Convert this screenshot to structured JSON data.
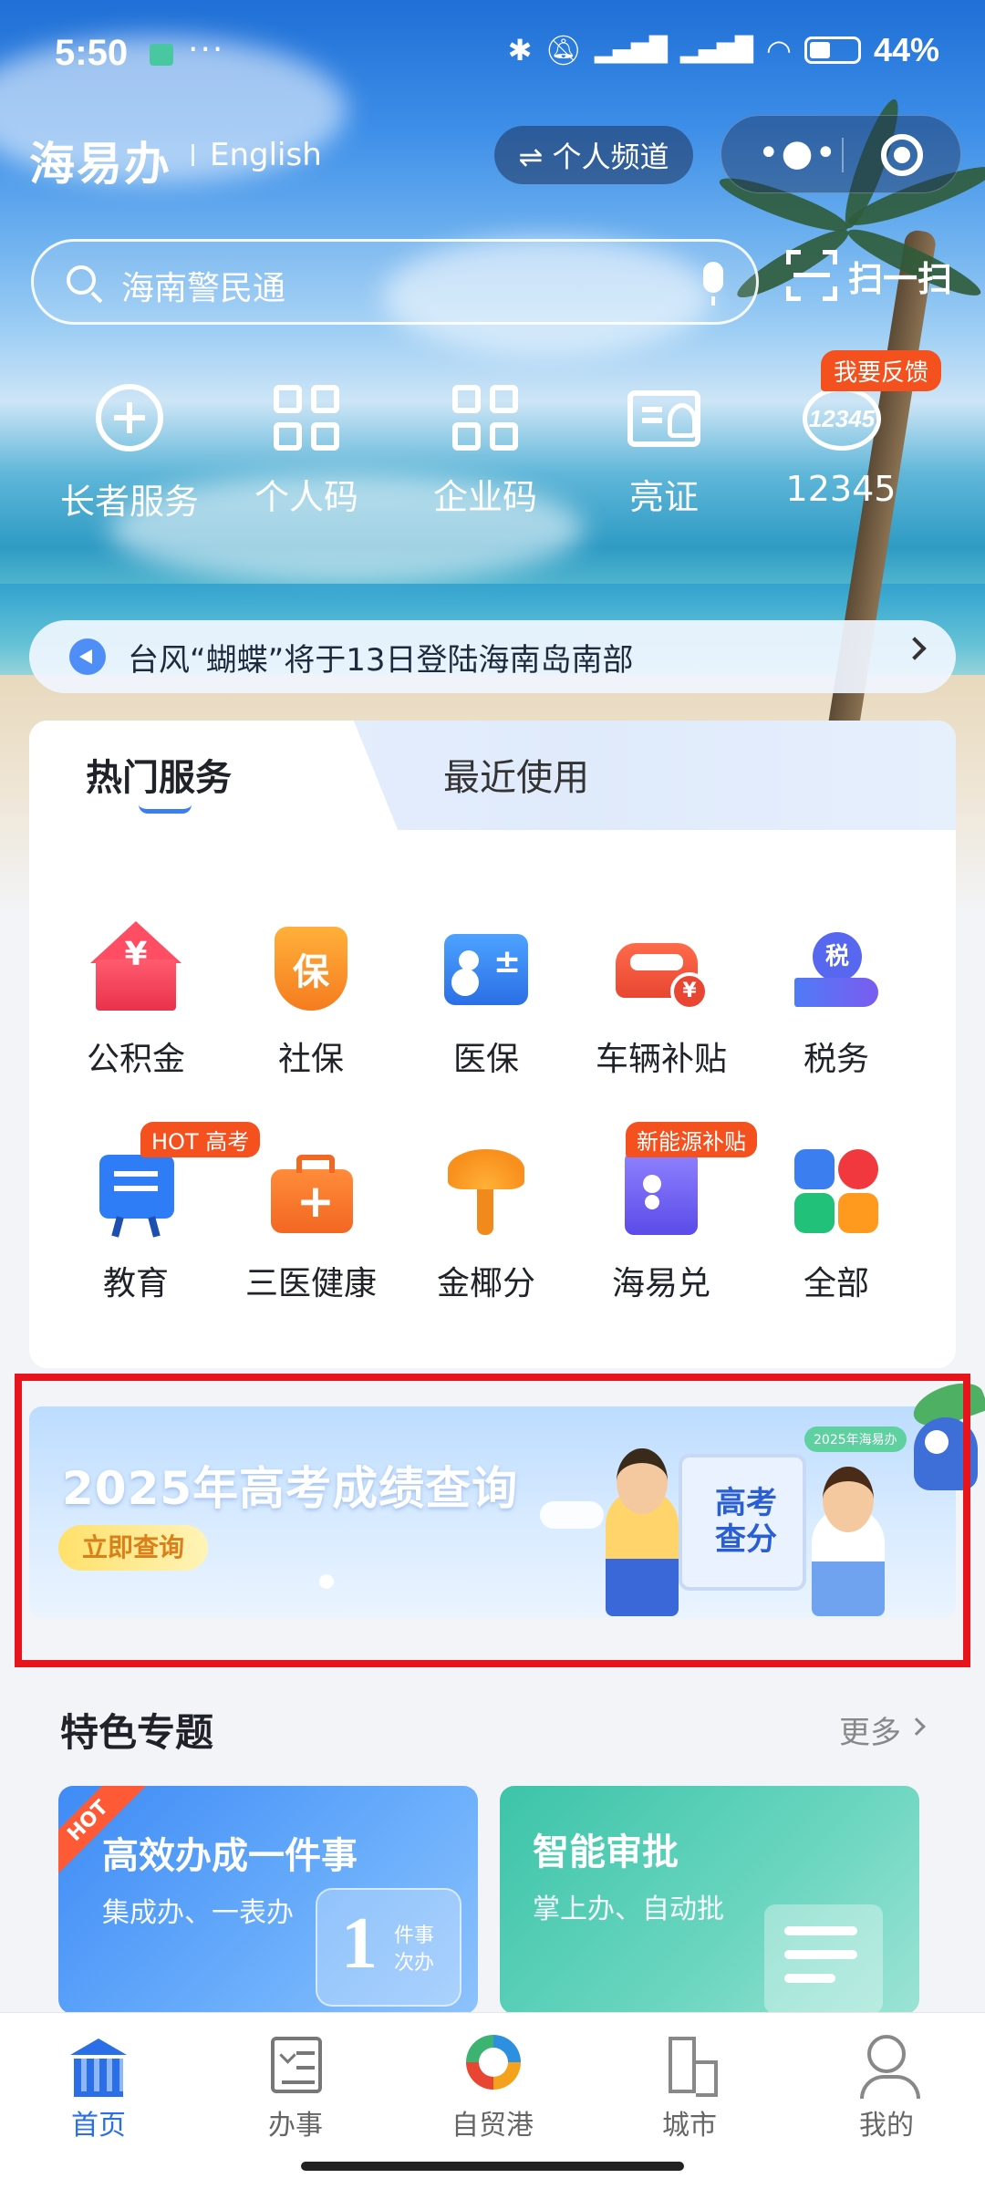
{
  "status_bar": {
    "time": "5:50",
    "more": "···",
    "battery": "44%"
  },
  "header": {
    "logo": "海易办",
    "language": "English",
    "channel_button": "⇌ 个人频道",
    "capsule_more": "•●•"
  },
  "search": {
    "placeholder": "海南警民通",
    "scan_label": "扫一扫"
  },
  "quick_tools": [
    {
      "label": "长者服务",
      "icon": "heart-plus-icon"
    },
    {
      "label": "个人码",
      "icon": "qr-grid-icon"
    },
    {
      "label": "企业码",
      "icon": "qr-grid-icon"
    },
    {
      "label": "亮证",
      "icon": "id-card-icon"
    },
    {
      "label": "12345",
      "icon": "hotline-12345-icon",
      "badge": "我要反馈"
    }
  ],
  "notice": {
    "text": "台风“蝴蝶”将于13日登陆海南岛南部"
  },
  "services": {
    "tabs": [
      {
        "label": "热门服务",
        "active": true
      },
      {
        "label": "最近使用",
        "active": false
      }
    ],
    "items": [
      {
        "label": "公积金",
        "icon": "housing-fund-icon"
      },
      {
        "label": "社保",
        "icon": "social-security-icon"
      },
      {
        "label": "医保",
        "icon": "medical-insurance-icon"
      },
      {
        "label": "车辆补贴",
        "icon": "vehicle-subsidy-icon"
      },
      {
        "label": "税务",
        "icon": "tax-icon"
      },
      {
        "label": "教育",
        "icon": "education-icon",
        "tag": "HOT 高考"
      },
      {
        "label": "三医健康",
        "icon": "medical-kit-icon"
      },
      {
        "label": "金椰分",
        "icon": "coconut-tree-icon"
      },
      {
        "label": "海易兑",
        "icon": "exchange-door-icon",
        "tag": "新能源补贴"
      },
      {
        "label": "全部",
        "icon": "all-apps-icon"
      }
    ]
  },
  "banner": {
    "title": "2025年高考成绩查询",
    "cta": "立即查询",
    "board_text": "高考\n查分",
    "badge": "2025年海易办"
  },
  "featured": {
    "title": "特色专题",
    "more": "更多",
    "cards": [
      {
        "title": "高效办成一件事",
        "subtitle": "集成办、一表办",
        "ribbon": "HOT",
        "deco_num": "1",
        "deco_text": "件事\n次办"
      },
      {
        "title": "智能审批",
        "subtitle": "掌上办、自动批"
      }
    ]
  },
  "bottom_nav": [
    {
      "label": "首页",
      "active": true
    },
    {
      "label": "办事",
      "active": false
    },
    {
      "label": "自贸港",
      "active": false
    },
    {
      "label": "城市",
      "active": false
    },
    {
      "label": "我的",
      "active": false
    }
  ],
  "colors": {
    "accent": "#2a6fe8",
    "badge_red": "#f4511e",
    "highlight": "#e8141b"
  }
}
